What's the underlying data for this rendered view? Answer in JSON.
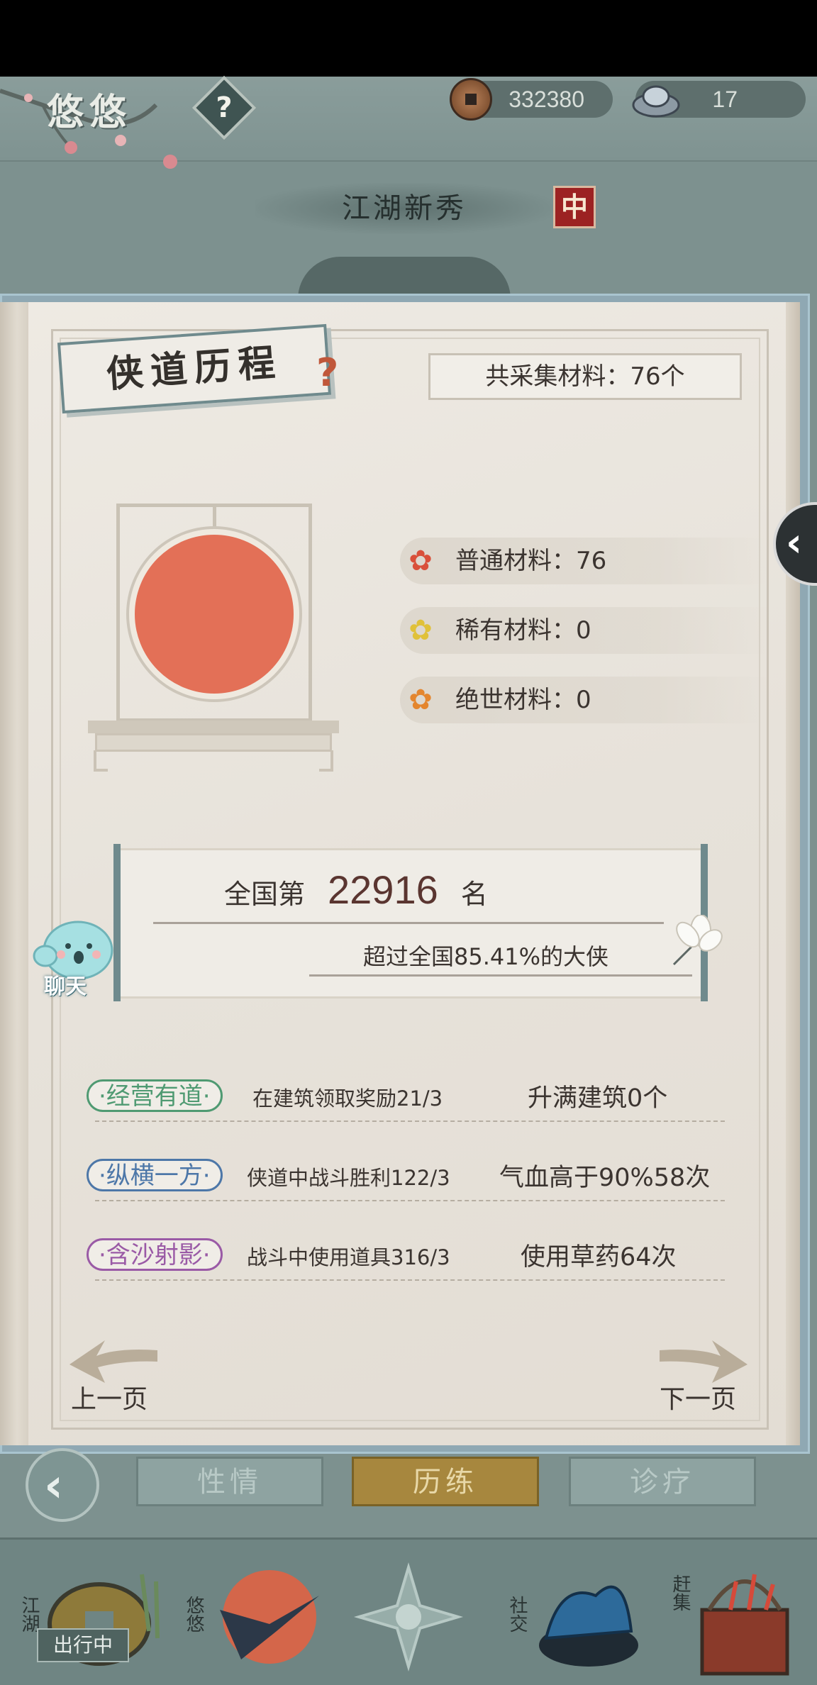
{
  "header": {
    "player_name": "悠悠",
    "help_symbol": "?",
    "copper_coins": "332380",
    "silver_ingots": "17",
    "rank_title": "江湖新秀",
    "rank_badge": "中"
  },
  "section": {
    "title": "侠道历程",
    "help_symbol": "?",
    "total_materials": "共采集材料：76个"
  },
  "materials": [
    {
      "label": "普通材料：76",
      "icon": "red-flower-icon",
      "color": "#d9503a"
    },
    {
      "label": "稀有材料：0",
      "icon": "yellow-flower-icon",
      "color": "#e0c13a"
    },
    {
      "label": "绝世材料：0",
      "icon": "orange-flower-icon",
      "color": "#e4862e"
    }
  ],
  "ranking": {
    "prefix": "全国第",
    "number": "22916",
    "suffix": "名",
    "subtitle": "超过全国85.41%的大侠"
  },
  "chat": {
    "label": "聊天"
  },
  "achievements": [
    {
      "tag": "·经营有道·",
      "desc": "在建筑领取奖励21/3",
      "goal": "升满建筑0个",
      "color": "#4f9a72"
    },
    {
      "tag": "·纵横一方·",
      "desc": "侠道中战斗胜利122/3",
      "goal": "气血高于90%58次",
      "color": "#4d77a8"
    },
    {
      "tag": "·含沙射影·",
      "desc": "战斗中使用道具316/3",
      "goal": "使用草药64次",
      "color": "#9a5aa6"
    }
  ],
  "pager": {
    "prev": "上一页",
    "next": "下一页"
  },
  "tabs": [
    {
      "label": "性情",
      "active": false
    },
    {
      "label": "历练",
      "active": true
    },
    {
      "label": "诊疗",
      "active": false
    }
  ],
  "dock": {
    "items": [
      {
        "label": "江湖",
        "badge": "出行中"
      },
      {
        "label": "悠悠"
      },
      {
        "label": ""
      },
      {
        "label": "社交"
      },
      {
        "label": "赶集"
      }
    ]
  }
}
